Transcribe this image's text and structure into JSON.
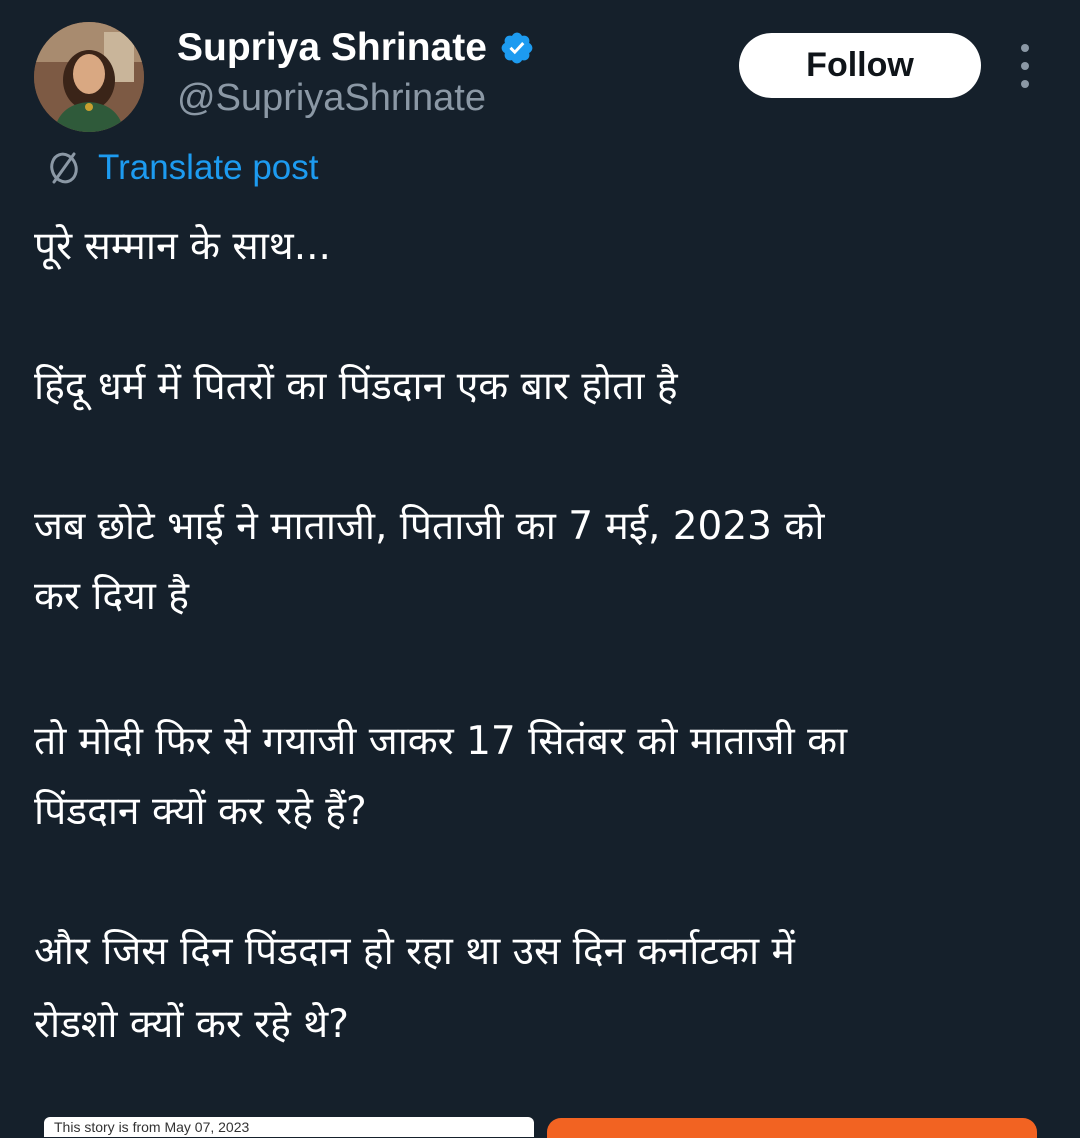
{
  "author": {
    "display_name": "Supriya Shrinate",
    "handle": "@SupriyaShrinate",
    "verified": true
  },
  "follow_button": {
    "label": "Follow"
  },
  "translate": {
    "label": "Translate post"
  },
  "post": {
    "line1": "पूरे सम्मान के साथ...",
    "line2": "हिंदू धर्म में पितरों का पिंडदान एक बार होता है",
    "line3": "जब छोटे भाई ने माताजी, पिताजी का 7 मई, 2023 को",
    "line4": "कर दिया है",
    "line5": "तो मोदी फिर से गयाजी जाकर 17 सितंबर को माताजी का",
    "line6": "पिंडदान क्यों कर रहे हैं?",
    "line7": "और जिस दिन पिंडदान हो रहा था उस दिन कर्नाटका में",
    "line8": "रोडशो क्यों कर रहे थे?"
  },
  "embed": {
    "left_caption": "This story is from May 07, 2023"
  },
  "colors": {
    "background": "#15202b",
    "text_primary": "#ffffff",
    "text_secondary": "#8b98a5",
    "link": "#1d9bf0",
    "verified_badge": "#1d9bf0",
    "embed_accent": "#f26322"
  },
  "icons": {
    "verified": "verified-badge-icon",
    "more": "more-vertical-icon",
    "translate": "translate-globe-icon"
  }
}
